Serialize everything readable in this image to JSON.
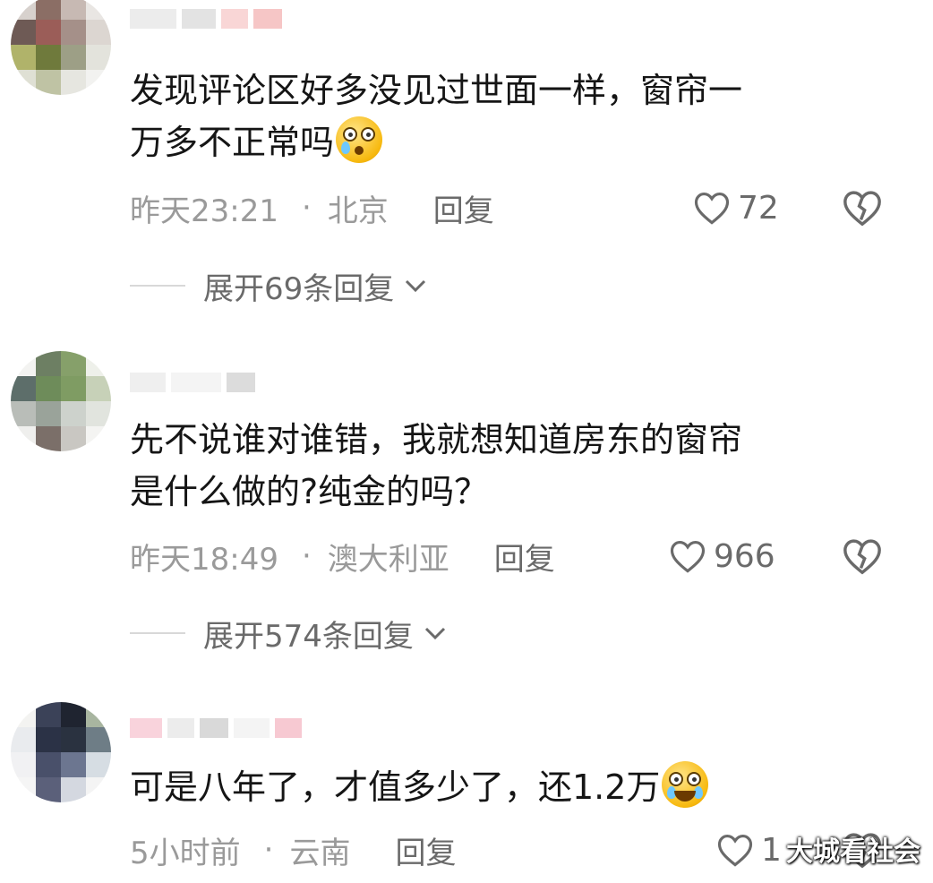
{
  "comments": [
    {
      "text_line1": "发现评论区好多没见过世面一样，窗帘一",
      "text_line2": "万多不正常吗",
      "emoji": "crying-face-emoji",
      "time": "昨天23:21",
      "location": "北京",
      "reply_label": "回复",
      "likes": "72",
      "expand_label": "展开69条回复"
    },
    {
      "text_line1": "先不说谁对谁错，我就想知道房东的窗帘",
      "text_line2": "是什么做的?纯金的吗？",
      "time": "昨天18:49",
      "location": "澳大利亚",
      "reply_label": "回复",
      "likes": "966",
      "expand_label": "展开574条回复"
    },
    {
      "text_line1": "可是八年了，才值多少了，还1.2万",
      "emoji": "laughing-tears-emoji",
      "time": "5小时前",
      "location": "云南",
      "reply_label": "回复",
      "likes": "1"
    }
  ],
  "separator": "·",
  "watermark": "大城看社会",
  "colors": {
    "text": "#151515",
    "meta": "#9a9a9a",
    "secondary": "#6a6a6a",
    "divider": "#d8d8d8"
  }
}
